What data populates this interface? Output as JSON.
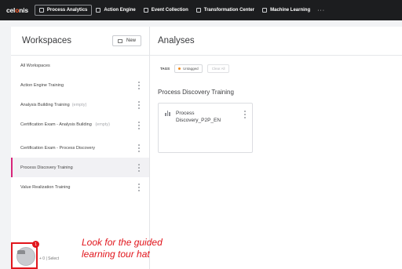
{
  "nav": {
    "logo": {
      "part1": "cel",
      "accent": "o",
      "part2": "nis"
    },
    "items": [
      {
        "label": "Process Analytics",
        "active": true
      },
      {
        "label": "Action Engine"
      },
      {
        "label": "Event Collection"
      },
      {
        "label": "Transformation Center"
      },
      {
        "label": "Machine Learning"
      }
    ],
    "more": "···"
  },
  "workspaces": {
    "title": "Workspaces",
    "new_label": "New",
    "items": [
      {
        "label": "All Workspaces",
        "kebab": false
      },
      {
        "label": "Action Engine Training",
        "kebab": true
      },
      {
        "label": "Analysis Building Training",
        "muted": "(empty)",
        "kebab": true
      },
      {
        "label": "Certification Exam - Analysis Building",
        "muted": "(empty)",
        "kebab": true,
        "tall": true
      },
      {
        "label": "Certification Exam - Process Discovery",
        "kebab": true
      },
      {
        "label": "Process Discovery Training",
        "kebab": true,
        "selected": true
      },
      {
        "label": "Value Realization Training",
        "kebab": true
      }
    ]
  },
  "analyses": {
    "title": "Analyses",
    "tags_label": "TAGS",
    "tag_chip": "Untagged",
    "clear_label": "Clear All",
    "section_title": "Process Discovery Training",
    "card": {
      "line1": "Process",
      "line2": "Discovery_P2P_EN"
    }
  },
  "overlay": {
    "badge_count": "1",
    "bottom_text": "+ 0 | Select",
    "callout_line1": "Look for the guided",
    "callout_line2": "learning tour hat"
  },
  "colors": {
    "accent": "#e1151c",
    "selected_bar": "#d8257a",
    "logo_accent": "#ff5f2e"
  }
}
